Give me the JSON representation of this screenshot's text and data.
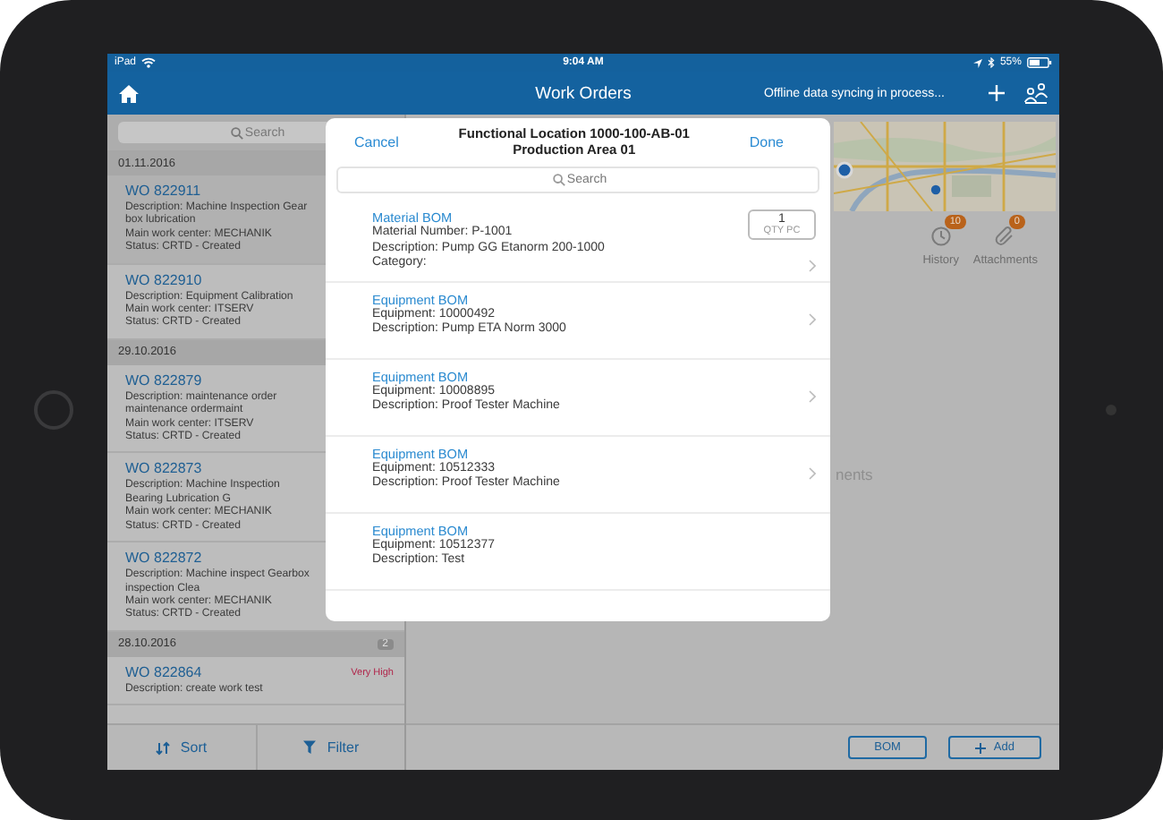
{
  "status_bar": {
    "carrier": "iPad",
    "time": "9:04 AM",
    "battery": "55%"
  },
  "nav_bar": {
    "title": "Work Orders",
    "sync_status": "Offline data syncing in process..."
  },
  "work_order_list": {
    "search": {
      "placeholder": "Search"
    },
    "groups": [
      {
        "date": "01.11.2016",
        "items": [
          {
            "number": "WO 822911",
            "selected": true,
            "lines": [
              "Description: Machine Inspection Gear box lubrication",
              "Main work center: MECHANIK",
              "Status: CRTD - Created"
            ]
          },
          {
            "number": "WO 822910",
            "selected": false,
            "lines": [
              "Description: Equipment Calibration",
              "Main work center: ITSERV",
              "Status: CRTD - Created"
            ]
          }
        ]
      },
      {
        "date": "29.10.2016",
        "items": [
          {
            "number": "WO 822879",
            "selected": false,
            "lines": [
              "Description: maintenance order maintenance ordermaint",
              "Main work center: ITSERV",
              "Status: CRTD - Created"
            ]
          },
          {
            "number": "WO 822873",
            "selected": false,
            "lines": [
              "Description: Machine Inspection Bearing Lubrication G",
              "Main work center: MECHANIK",
              "Status: CRTD - Created"
            ]
          },
          {
            "number": "WO 822872",
            "selected": false,
            "lines": [
              "Description: Machine inspect Gearbox inspection Clea",
              "Main work center: MECHANIK",
              "Status: CRTD - Created"
            ]
          }
        ]
      },
      {
        "date": "28.10.2016",
        "count": "2",
        "items": [
          {
            "number": "WO 822864",
            "selected": false,
            "priority": "Very High",
            "lines": [
              "Description: create work test"
            ]
          }
        ]
      }
    ]
  },
  "list_toolbar": {
    "buttons": [
      {
        "label": "Sort",
        "kind": "sort"
      },
      {
        "label": "Filter",
        "kind": "filter"
      }
    ]
  },
  "detail": {
    "tabs": [
      {
        "label": "History",
        "badge": "10",
        "kind": "history"
      },
      {
        "label": "Attachments",
        "badge": "0",
        "kind": "attachments"
      }
    ],
    "section_label": "nents",
    "actions": [
      {
        "label": "BOM",
        "kind": "plain"
      },
      {
        "label": "Add",
        "kind": "add"
      }
    ]
  },
  "bom_sheet": {
    "cancel": "Cancel",
    "title_lines": [
      "Functional Location 1000-100-AB-01",
      "Production Area 01"
    ],
    "done": "Done",
    "search": {
      "placeholder": "Search"
    },
    "rows": [
      {
        "title": "Material BOM",
        "lines": [
          "Material Number: P-1001",
          "Description: Pump GG  Etanorm 200-1000",
          "Category:"
        ],
        "quantity": {
          "value": "1",
          "unit": "QTY PC"
        },
        "chevron": true
      },
      {
        "title": "Equipment BOM",
        "lines": [
          "Equipment: 10000492",
          "Description: Pump ETA Norm 3000"
        ],
        "chevron": true
      },
      {
        "title": "Equipment BOM",
        "lines": [
          "Equipment: 10008895",
          "Description: Proof Tester Machine"
        ],
        "chevron": true
      },
      {
        "title": "Equipment BOM",
        "lines": [
          "Equipment: 10512333",
          "Description: Proof Tester Machine"
        ],
        "chevron": true
      },
      {
        "title": "Equipment BOM",
        "lines": [
          "Equipment: 10512377",
          "Description: Test"
        ],
        "chevron": false
      }
    ]
  }
}
